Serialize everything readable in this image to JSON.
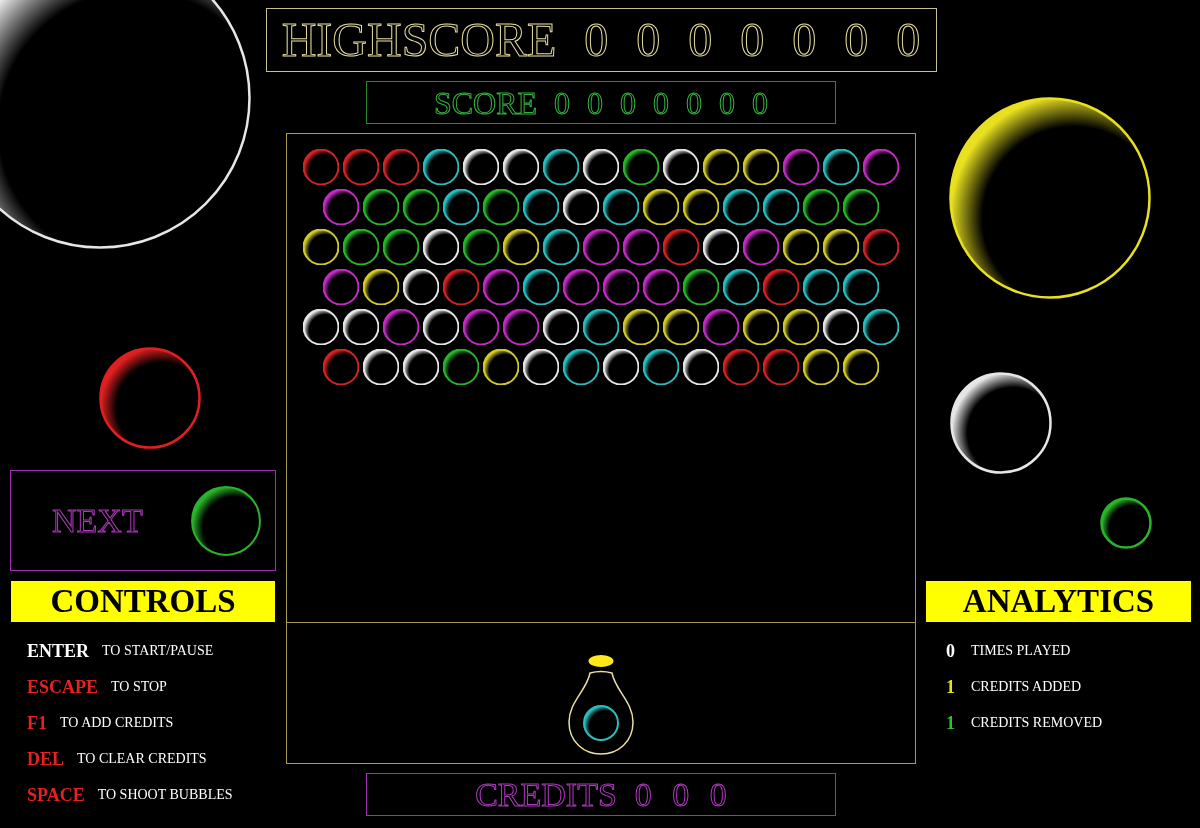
{
  "highscore": {
    "label": "HIGHSCORE",
    "value": "0 0 0 0 0 0 0"
  },
  "score": {
    "label": "SCORE",
    "value": "0 0 0 0 0 0 0"
  },
  "floating_bubbles": [
    {
      "color": "#e6e6e6"
    },
    {
      "color": "#e8e020"
    },
    {
      "color": "#e02020"
    },
    {
      "color": "#e6e6e6"
    },
    {
      "color": "#2ab42a"
    }
  ],
  "board": {
    "rows": [
      {
        "bubbles": [
          {
            "color": "#d42424"
          },
          {
            "color": "#d42424"
          },
          {
            "color": "#d42424"
          },
          {
            "color": "#2cbcbc"
          },
          {
            "color": "#e6e6e6"
          },
          {
            "color": "#e6e6e6"
          },
          {
            "color": "#2cbcbc"
          },
          {
            "color": "#e6e6e6"
          },
          {
            "color": "#2ab42a"
          },
          {
            "color": "#e6e6e6"
          },
          {
            "color": "#d2ca2a"
          },
          {
            "color": "#d2ca2a"
          },
          {
            "color": "#c42cc4"
          },
          {
            "color": "#2cbcbc"
          },
          {
            "color": "#c42cc4"
          }
        ]
      },
      {
        "bubbles": [
          {
            "color": "#c42cc4"
          },
          {
            "color": "#2ab42a"
          },
          {
            "color": "#2ab42a"
          },
          {
            "color": "#2cbcbc"
          },
          {
            "color": "#2ab42a"
          },
          {
            "color": "#2cbcbc"
          },
          {
            "color": "#e6e6e6"
          },
          {
            "color": "#2cbcbc"
          },
          {
            "color": "#d2ca2a"
          },
          {
            "color": "#d2ca2a"
          },
          {
            "color": "#2cbcbc"
          },
          {
            "color": "#2cbcbc"
          },
          {
            "color": "#2ab42a"
          },
          {
            "color": "#2ab42a"
          }
        ]
      },
      {
        "bubbles": [
          {
            "color": "#d2ca2a"
          },
          {
            "color": "#2ab42a"
          },
          {
            "color": "#2ab42a"
          },
          {
            "color": "#e6e6e6"
          },
          {
            "color": "#2ab42a"
          },
          {
            "color": "#d2ca2a"
          },
          {
            "color": "#2cbcbc"
          },
          {
            "color": "#c42cc4"
          },
          {
            "color": "#c42cc4"
          },
          {
            "color": "#d42424"
          },
          {
            "color": "#e6e6e6"
          },
          {
            "color": "#c42cc4"
          },
          {
            "color": "#d2ca2a"
          },
          {
            "color": "#d2ca2a"
          },
          {
            "color": "#d42424"
          }
        ]
      },
      {
        "bubbles": [
          {
            "color": "#c42cc4"
          },
          {
            "color": "#d2ca2a"
          },
          {
            "color": "#e6e6e6"
          },
          {
            "color": "#d42424"
          },
          {
            "color": "#c42cc4"
          },
          {
            "color": "#2cbcbc"
          },
          {
            "color": "#c42cc4"
          },
          {
            "color": "#c42cc4"
          },
          {
            "color": "#c42cc4"
          },
          {
            "color": "#2ab42a"
          },
          {
            "color": "#2cbcbc"
          },
          {
            "color": "#d42424"
          },
          {
            "color": "#2cbcbc"
          },
          {
            "color": "#2cbcbc"
          }
        ]
      },
      {
        "bubbles": [
          {
            "color": "#e6e6e6"
          },
          {
            "color": "#e6e6e6"
          },
          {
            "color": "#c42cc4"
          },
          {
            "color": "#e6e6e6"
          },
          {
            "color": "#c42cc4"
          },
          {
            "color": "#c42cc4"
          },
          {
            "color": "#e6e6e6"
          },
          {
            "color": "#2cbcbc"
          },
          {
            "color": "#d2ca2a"
          },
          {
            "color": "#d2ca2a"
          },
          {
            "color": "#c42cc4"
          },
          {
            "color": "#d2ca2a"
          },
          {
            "color": "#d2ca2a"
          },
          {
            "color": "#e6e6e6"
          },
          {
            "color": "#2cbcbc"
          }
        ]
      },
      {
        "bubbles": [
          {
            "color": "#d42424"
          },
          {
            "color": "#e6e6e6"
          },
          {
            "color": "#e6e6e6"
          },
          {
            "color": "#2ab42a"
          },
          {
            "color": "#d2ca2a"
          },
          {
            "color": "#e6e6e6"
          },
          {
            "color": "#2cbcbc"
          },
          {
            "color": "#e6e6e6"
          },
          {
            "color": "#2cbcbc"
          },
          {
            "color": "#e6e6e6"
          },
          {
            "color": "#d42424"
          },
          {
            "color": "#d42424"
          },
          {
            "color": "#d2ca2a"
          },
          {
            "color": "#d2ca2a"
          }
        ]
      }
    ],
    "shooter": {
      "color": "#2cbcbc"
    }
  },
  "credits": {
    "label": "CREDITS",
    "value": "0 0 0"
  },
  "next": {
    "label": "NEXT",
    "bubble": {
      "color": "#2ab42a"
    }
  },
  "controls": {
    "title": "CONTROLS",
    "items": [
      {
        "key": "ENTER",
        "action": "TO START/PAUSE",
        "color": "#ffffff"
      },
      {
        "key": "ESCAPE",
        "action": "TO STOP",
        "color": "#e42222"
      },
      {
        "key": "F1",
        "action": "TO ADD CREDITS",
        "color": "#e42222"
      },
      {
        "key": "DEL",
        "action": "TO CLEAR CREDITS",
        "color": "#e42222"
      },
      {
        "key": "SPACE",
        "action": "TO SHOOT BUBBLES",
        "color": "#e42222"
      }
    ]
  },
  "analytics": {
    "title": "ANALYTICS",
    "items": [
      {
        "value": "0",
        "label": "TIMES PLAYED",
        "color": "#ffffff"
      },
      {
        "value": "1",
        "label": "CREDITS ADDED",
        "color": "#e8e020"
      },
      {
        "value": "1",
        "label": "CREDITS REMOVED",
        "color": "#30c030"
      }
    ]
  }
}
